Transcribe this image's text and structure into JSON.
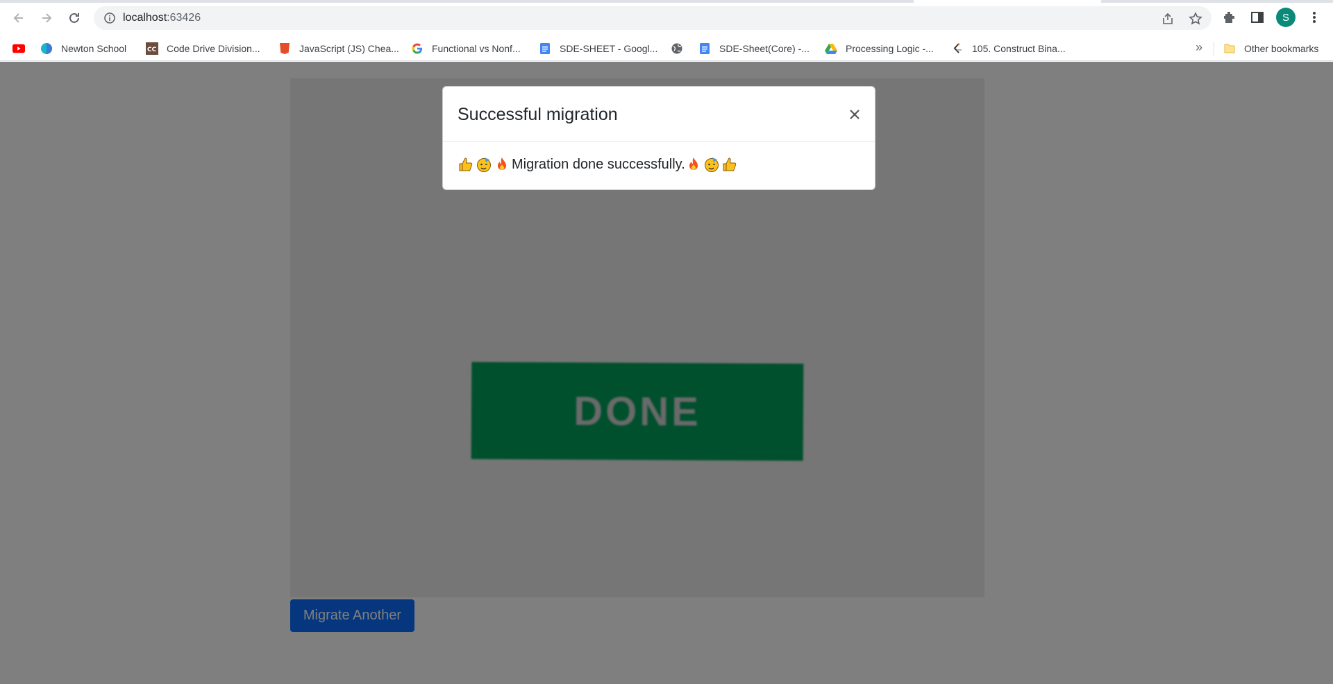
{
  "browser": {
    "url_host": "localhost",
    "url_port": ":63426",
    "profile_initial": "S",
    "bookmarks": [
      {
        "label": ""
      },
      {
        "label": "Newton School"
      },
      {
        "label": "Code Drive Division..."
      },
      {
        "label": "JavaScript (JS) Chea..."
      },
      {
        "label": "Functional vs Nonf..."
      },
      {
        "label": "SDE-SHEET - Googl..."
      },
      {
        "label": ""
      },
      {
        "label": "SDE-Sheet(Core) -..."
      },
      {
        "label": "Processing Logic -..."
      },
      {
        "label": "105. Construct Bina..."
      }
    ],
    "more_label": "»",
    "other_bookmarks": "Other bookmarks"
  },
  "page": {
    "banner_text": "DONE",
    "migrate_button": "Migrate Another"
  },
  "modal": {
    "title": "Successful migration",
    "close": "×",
    "message": "Migration done successfully."
  },
  "colors": {
    "banner": "#00a05b",
    "button": "#0d6efd",
    "avatar": "#0b8a7a"
  }
}
